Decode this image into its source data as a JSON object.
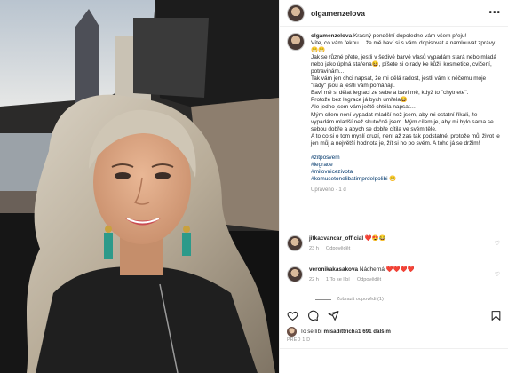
{
  "post": {
    "username": "olgamenzelova",
    "more_icon": "more-horizontal-icon",
    "caption": {
      "username": "olgamenzelova",
      "lines": [
        "Krásný pondělní dopoledne vám všem přeju!",
        "Víte, co vám řeknu… že mě baví si s vámi dopisovat a namlouvat zprávy😁😁",
        "Jak se různé přete, jestli v šedivé barvě vlasů vypadám stará nebo mladá nebo jako úplná stařena😆, píšete si o rady ke kůži, kosmetice, cvičení, potravinám...",
        "Tak vám jen chci napsat, že mi dělá radost, jestli vám k něčemu moje \"rady\" jsou a jestli vám pomáhají.",
        "Baví mě si dělat legraci ze sebe a baví mě, když to \"chytnete\".",
        "Protože bez legrace já bych umřela😆",
        "Ale jedno jsem vám ještě chtěla napsat…",
        "Mým cílem není vypadat mladší než jsem, aby mi ostatní říkali, že vypadám mladší než skutečně jsem. Mým cílem je, aby mi bylo sama se sebou dobře a abych se dobře cítila ve svém těle.",
        "A to co si o tom myslí druzí, není až zas tak podstatné, protože můj život je jen můj a největší hodnota je, žít si ho po svém. A toho já se držím!"
      ],
      "hashtags": [
        "#zitposvem",
        "#legrace",
        "#milovnicezivota",
        "#komusetonelibatimprdelpolibi 😁"
      ],
      "meta": "Upraveno · 1 d"
    },
    "comments": [
      {
        "username": "jitkacvancar_official",
        "text": "❤️😍😂",
        "age": "23 h",
        "likes_text": "",
        "reply_label": "Odpovědět"
      },
      {
        "username": "veronikakasakova",
        "text": "Nádherná ❤️❤️❤️❤️",
        "age": "22 h",
        "likes_text": "1 To se líbí",
        "reply_label": "Odpovědět"
      }
    ],
    "show_replies": "Zobrazit odpovědi (1)",
    "likes_line": {
      "prefix": "To se líbí ",
      "user": "misadittrich",
      "middle": " a ",
      "count": "1 691 dalším"
    },
    "timestamp": "PŘED 1 D",
    "icons": [
      "heart-icon",
      "comment-icon",
      "share-icon",
      "bookmark-icon"
    ]
  }
}
